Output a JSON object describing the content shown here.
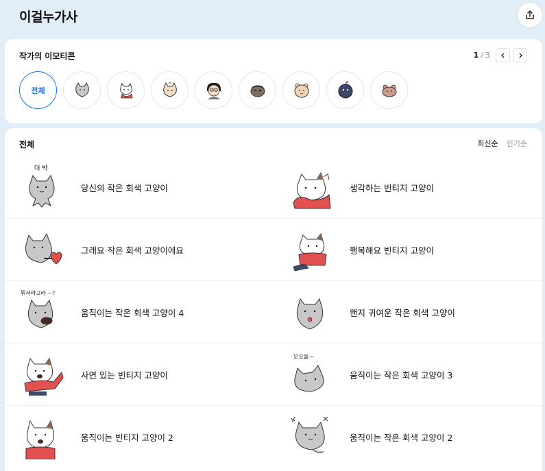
{
  "header": {
    "title": "이걸누가사"
  },
  "artist_emoticons": {
    "title": "작가의 이모티콘",
    "pager": {
      "current": "1",
      "separator": "/",
      "total": "3"
    },
    "all_label": "전체",
    "thumbs": [
      {
        "icon": "gray-cat-icon"
      },
      {
        "icon": "vintage-cat-icon"
      },
      {
        "icon": "beige-cat-icon"
      },
      {
        "icon": "glasses-person-icon"
      },
      {
        "icon": "brown-cat-icon"
      },
      {
        "icon": "peach-bear-icon"
      },
      {
        "icon": "navy-creature-icon"
      },
      {
        "icon": "pink-bear-icon"
      }
    ]
  },
  "list": {
    "title": "전체",
    "sort": {
      "latest": "최신순",
      "popular": "인기순"
    },
    "rows": [
      [
        {
          "label": "당신의 작은 회색 고양이",
          "caption": "대 박",
          "icon": "gray-cat-sticker-icon"
        },
        {
          "label": "생각하는 빈티지 고양이",
          "icon": "vintage-cat-sticker-icon"
        }
      ],
      [
        {
          "label": "그래요 작은 회색 고양이에요",
          "icon": "gray-cat-heart-icon"
        },
        {
          "label": "행복해요 빈티지 고양이",
          "icon": "vintage-cat-happy-icon"
        }
      ],
      [
        {
          "label": "움직이는 작은 회색 고양이 4",
          "caption": "뭐서라고라 ~?",
          "icon": "gray-cat-shout-icon"
        },
        {
          "label": "왠지 귀여운 작은 회색 고양이",
          "icon": "gray-cat-cute-icon"
        }
      ],
      [
        {
          "label": "사연 있는 빈티지 고양이",
          "icon": "vintage-cat-wave-icon"
        },
        {
          "label": "움직이는 작은 회색 고양이 3",
          "caption": "오오울—",
          "icon": "gray-cat-lying-icon"
        }
      ],
      [
        {
          "label": "움직이는 빈티지 고양이 2",
          "icon": "vintage-cat-mouth-icon"
        },
        {
          "label": "움직이는 작은 회색 고양이 2",
          "icon": "gray-cat-sparkle-icon"
        }
      ]
    ]
  },
  "colors": {
    "accent": "#1a73e8",
    "background": "#e1eef8",
    "gray_cat": "#c8c8c8",
    "red_shirt": "#e2504f"
  }
}
